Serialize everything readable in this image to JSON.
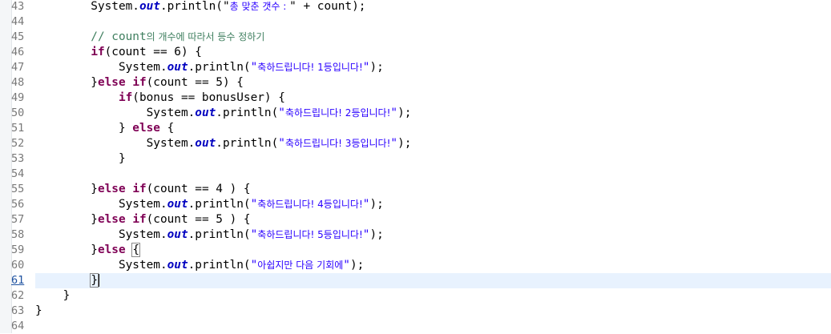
{
  "editor": {
    "lines": [
      {
        "n": "43",
        "tokens": [
          {
            "t": "        System.",
            "c": ""
          },
          {
            "t": "out",
            "c": "fld"
          },
          {
            "t": ".println(\"",
            "c": ""
          },
          {
            "t": "총 맞춘 갯수 : ",
            "c": "str ko"
          },
          {
            "t": "\" + count);",
            "c": ""
          }
        ]
      },
      {
        "n": "44",
        "tokens": []
      },
      {
        "n": "45",
        "tokens": [
          {
            "t": "        // count",
            "c": "cm"
          },
          {
            "t": "의 개수에 따라서 등수 정하기",
            "c": "cm ko"
          }
        ]
      },
      {
        "n": "46",
        "tokens": [
          {
            "t": "        ",
            "c": ""
          },
          {
            "t": "if",
            "c": "kw"
          },
          {
            "t": "(count == 6) {",
            "c": ""
          }
        ]
      },
      {
        "n": "47",
        "tokens": [
          {
            "t": "            System.",
            "c": ""
          },
          {
            "t": "out",
            "c": "fld"
          },
          {
            "t": ".println(",
            "c": ""
          },
          {
            "t": "\"",
            "c": "str"
          },
          {
            "t": "축하드립니다! 1등입니다!",
            "c": "str ko"
          },
          {
            "t": "\"",
            "c": "str"
          },
          {
            "t": ");",
            "c": ""
          }
        ]
      },
      {
        "n": "48",
        "tokens": [
          {
            "t": "        }",
            "c": ""
          },
          {
            "t": "else",
            "c": "kw"
          },
          {
            "t": " ",
            "c": ""
          },
          {
            "t": "if",
            "c": "kw"
          },
          {
            "t": "(count == 5) {",
            "c": ""
          }
        ]
      },
      {
        "n": "49",
        "tokens": [
          {
            "t": "            ",
            "c": ""
          },
          {
            "t": "if",
            "c": "kw"
          },
          {
            "t": "(bonus == bonusUser) {",
            "c": ""
          }
        ]
      },
      {
        "n": "50",
        "tokens": [
          {
            "t": "                System.",
            "c": ""
          },
          {
            "t": "out",
            "c": "fld"
          },
          {
            "t": ".println(",
            "c": ""
          },
          {
            "t": "\"",
            "c": "str"
          },
          {
            "t": "축하드립니다! 2등입니다!",
            "c": "str ko"
          },
          {
            "t": "\"",
            "c": "str"
          },
          {
            "t": ");",
            "c": ""
          }
        ]
      },
      {
        "n": "51",
        "tokens": [
          {
            "t": "            } ",
            "c": ""
          },
          {
            "t": "else",
            "c": "kw"
          },
          {
            "t": " {",
            "c": ""
          }
        ]
      },
      {
        "n": "52",
        "tokens": [
          {
            "t": "                System.",
            "c": ""
          },
          {
            "t": "out",
            "c": "fld"
          },
          {
            "t": ".println(",
            "c": ""
          },
          {
            "t": "\"",
            "c": "str"
          },
          {
            "t": "축하드립니다! 3등입니다!",
            "c": "str ko"
          },
          {
            "t": "\"",
            "c": "str"
          },
          {
            "t": ");",
            "c": ""
          }
        ]
      },
      {
        "n": "53",
        "tokens": [
          {
            "t": "            }",
            "c": ""
          }
        ]
      },
      {
        "n": "54",
        "tokens": []
      },
      {
        "n": "55",
        "tokens": [
          {
            "t": "        }",
            "c": ""
          },
          {
            "t": "else",
            "c": "kw"
          },
          {
            "t": " ",
            "c": ""
          },
          {
            "t": "if",
            "c": "kw"
          },
          {
            "t": "(count == 4 ) {",
            "c": ""
          }
        ]
      },
      {
        "n": "56",
        "tokens": [
          {
            "t": "            System.",
            "c": ""
          },
          {
            "t": "out",
            "c": "fld"
          },
          {
            "t": ".println(",
            "c": ""
          },
          {
            "t": "\"",
            "c": "str"
          },
          {
            "t": "축하드립니다! 4등입니다!",
            "c": "str ko"
          },
          {
            "t": "\"",
            "c": "str"
          },
          {
            "t": ");",
            "c": ""
          }
        ]
      },
      {
        "n": "57",
        "tokens": [
          {
            "t": "        }",
            "c": ""
          },
          {
            "t": "else",
            "c": "kw"
          },
          {
            "t": " ",
            "c": ""
          },
          {
            "t": "if",
            "c": "kw"
          },
          {
            "t": "(count == 5 ) {",
            "c": ""
          }
        ]
      },
      {
        "n": "58",
        "tokens": [
          {
            "t": "            System.",
            "c": ""
          },
          {
            "t": "out",
            "c": "fld"
          },
          {
            "t": ".println(",
            "c": ""
          },
          {
            "t": "\"",
            "c": "str"
          },
          {
            "t": "축하드립니다! 5등입니다!",
            "c": "str ko"
          },
          {
            "t": "\"",
            "c": "str"
          },
          {
            "t": ");",
            "c": ""
          }
        ]
      },
      {
        "n": "59",
        "tokens": [
          {
            "t": "        }",
            "c": ""
          },
          {
            "t": "else",
            "c": "kw"
          },
          {
            "t": " ",
            "c": ""
          },
          {
            "t": "{",
            "c": "box"
          }
        ]
      },
      {
        "n": "60",
        "tokens": [
          {
            "t": "            System.",
            "c": ""
          },
          {
            "t": "out",
            "c": "fld"
          },
          {
            "t": ".println(",
            "c": ""
          },
          {
            "t": "\"",
            "c": "str"
          },
          {
            "t": "아쉽지만 다음 기회에",
            "c": "str ko"
          },
          {
            "t": "\"",
            "c": "str"
          },
          {
            "t": ");",
            "c": ""
          }
        ]
      },
      {
        "n": "61",
        "current": true,
        "tokens": [
          {
            "t": "        ",
            "c": ""
          },
          {
            "t": "}",
            "c": "box"
          },
          {
            "t": "",
            "c": "caret"
          }
        ]
      },
      {
        "n": "62",
        "tokens": [
          {
            "t": "    }",
            "c": ""
          }
        ]
      },
      {
        "n": "63",
        "tokens": [
          {
            "t": "}",
            "c": ""
          }
        ]
      },
      {
        "n": "64",
        "tokens": []
      }
    ],
    "colors": {
      "keyword": "#7f0055",
      "field": "#0000c0",
      "string": "#2a00ff",
      "comment": "#3f7f5f",
      "current_line": "#e8f2fe",
      "line_number": "#787878"
    }
  }
}
